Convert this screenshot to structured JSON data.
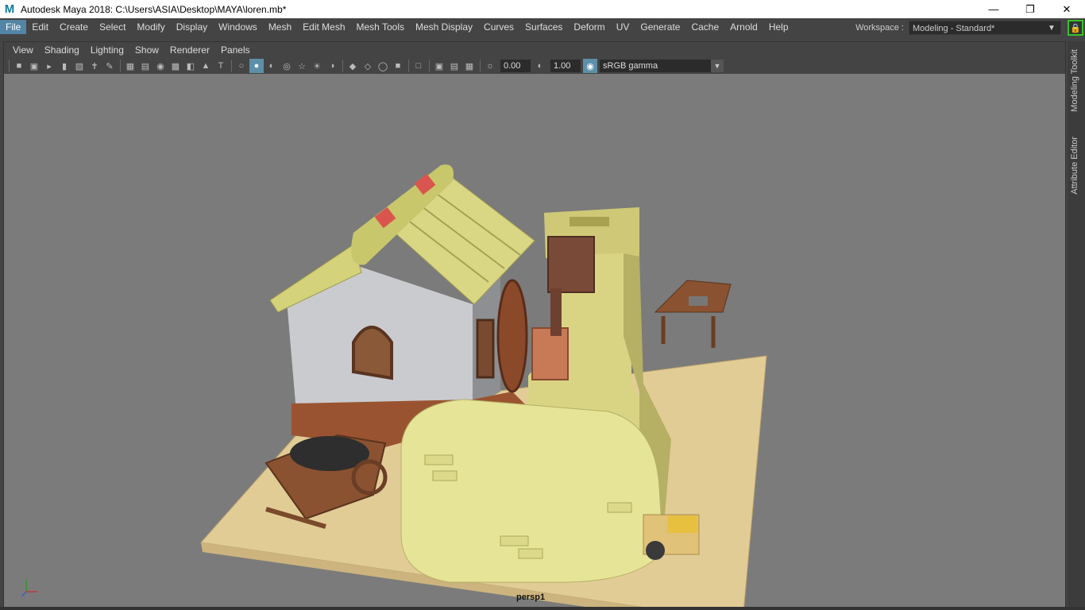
{
  "window": {
    "title": "Autodesk Maya 2018: C:\\Users\\ASIA\\Desktop\\MAYA\\loren.mb*",
    "app_icon": "maya-logo-icon"
  },
  "menu": [
    "File",
    "Edit",
    "Create",
    "Select",
    "Modify",
    "Display",
    "Windows",
    "Mesh",
    "Edit Mesh",
    "Mesh Tools",
    "Mesh Display",
    "Curves",
    "Surfaces",
    "Deform",
    "UV",
    "Generate",
    "Cache",
    "Arnold",
    "Help"
  ],
  "workspace": {
    "label": "Workspace :",
    "value": "Modeling - Standard*"
  },
  "panel_menu": [
    "View",
    "Shading",
    "Lighting",
    "Show",
    "Renderer",
    "Panels"
  ],
  "toolbar": {
    "exposure": "0.00",
    "gamma": "1.00",
    "color_space": "sRGB gamma"
  },
  "viewport": {
    "camera": "persp1",
    "background": "#7b7b7b"
  },
  "side_tabs": [
    "Modeling Toolkit",
    "Attribute Editor"
  ],
  "colors": {
    "accent": "#5285a6",
    "lock_border": "#39c02b",
    "wall": "#c9cbcf",
    "roof": "#d4d27a",
    "wood": "#7a4a30",
    "base": "#e2cc96"
  }
}
